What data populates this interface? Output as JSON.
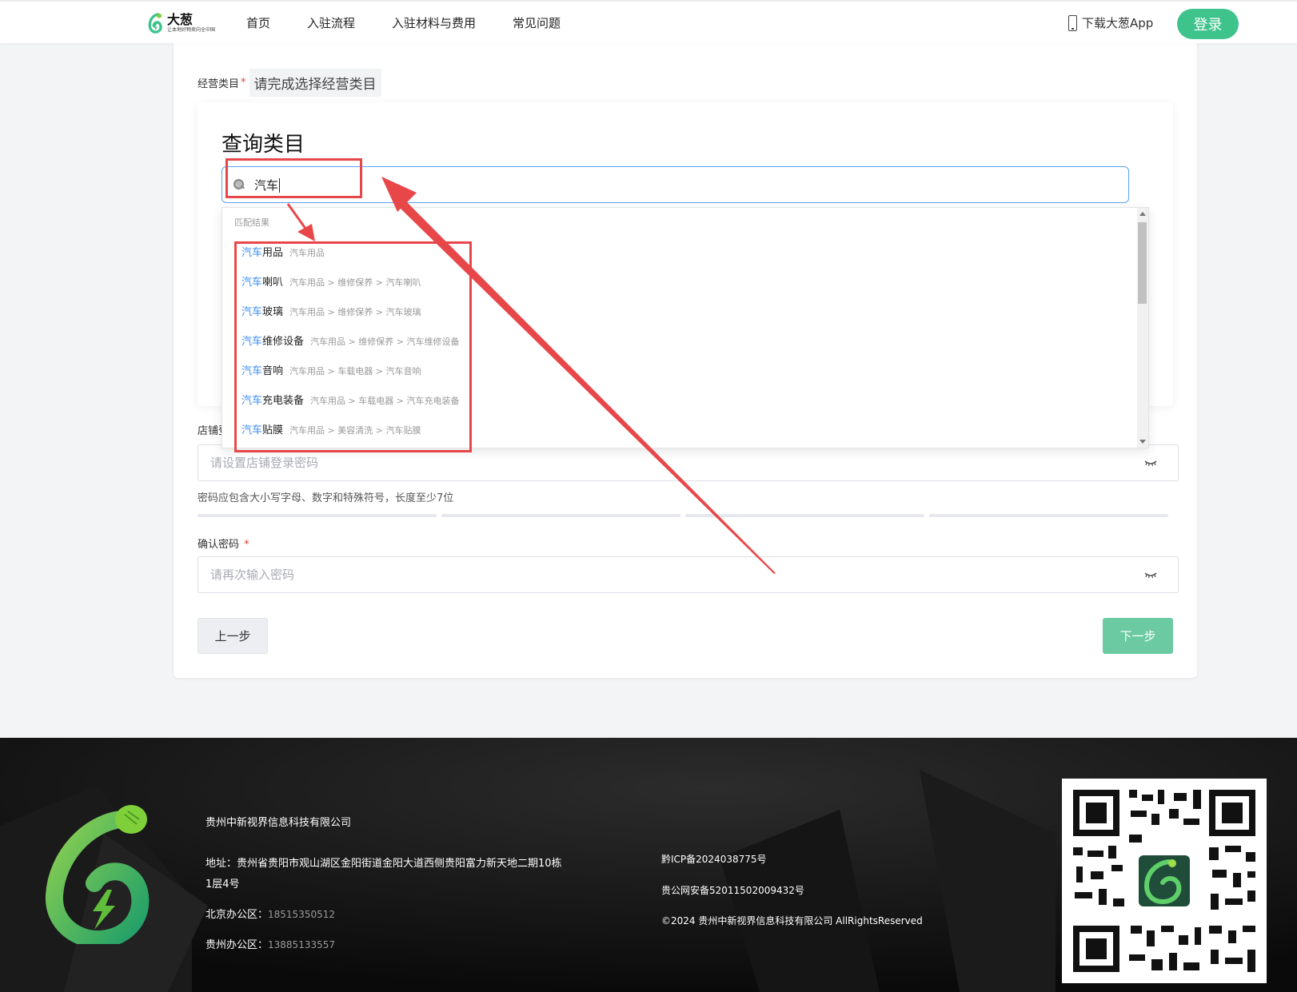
{
  "header": {
    "logo_name": "大葱",
    "logo_slogan": "让本地好物卖向全中国",
    "nav": [
      "首页",
      "入驻流程",
      "入驻材料与费用",
      "常见问题"
    ],
    "download_app": "下载大葱App",
    "login": "登录"
  },
  "form": {
    "category_label": "经营类目",
    "required_mark": "*",
    "category_value": "请完成选择经营类目",
    "query_title": "查询类目",
    "search_value": "汽车",
    "dropdown": {
      "header": "匹配结果",
      "items": [
        {
          "hl": "汽车",
          "rest": "用品",
          "path": "汽车用品"
        },
        {
          "hl": "汽车",
          "rest": "喇叭",
          "path": "汽车用品 > 维修保养 > 汽车喇叭"
        },
        {
          "hl": "汽车",
          "rest": "玻璃",
          "path": "汽车用品 > 维修保养 > 汽车玻璃"
        },
        {
          "hl": "汽车",
          "rest": "维修设备",
          "path": "汽车用品 > 维修保养 > 汽车维修设备"
        },
        {
          "hl": "汽车",
          "rest": "音响",
          "path": "汽车用品 > 车载电器 > 汽车音响"
        },
        {
          "hl": "汽车",
          "rest": "充电装备",
          "path": "汽车用品 > 车载电器 > 汽车充电装备"
        },
        {
          "hl": "汽车",
          "rest": "贴膜",
          "path": "汽车用品 > 美容清洗 > 汽车贴膜"
        }
      ]
    },
    "shop_password_label": "店铺登",
    "shop_password_placeholder": "请设置店铺登录密码",
    "password_hint": "密码应包含大小写字母、数字和特殊符号，长度至少7位",
    "confirm_label": "确认密码",
    "confirm_placeholder": "请再次输入密码",
    "prev": "上一步",
    "next": "下一步"
  },
  "footer": {
    "company": "贵州中新视界信息科技有限公司",
    "address_label": "地址：",
    "address": "贵州省贵阳市观山湖区金阳街道金阳大道西侧贵阳富力新天地二期10栋1层4号",
    "beijing_label": "北京办公区：",
    "beijing_phone": "18515350512",
    "guizhou_label": "贵州办公区：",
    "guizhou_phone": "13885133557",
    "icp": "黔ICP备2024038775号",
    "gongan": "贵公网安备52011502009432号",
    "copyright": "©2024  贵州中新视界信息科技有限公司 AllRightsReserved"
  },
  "colors": {
    "brand_green": "#3ec38d",
    "next_button": "#6bcaa2",
    "highlight_blue": "#3b8ff5",
    "annotation_red": "#e8474a",
    "footer_bg": "#0d0d0d"
  },
  "icons": [
    "logo-icon",
    "phone-icon",
    "search-icon",
    "eye-closed-icon",
    "qr-code"
  ]
}
